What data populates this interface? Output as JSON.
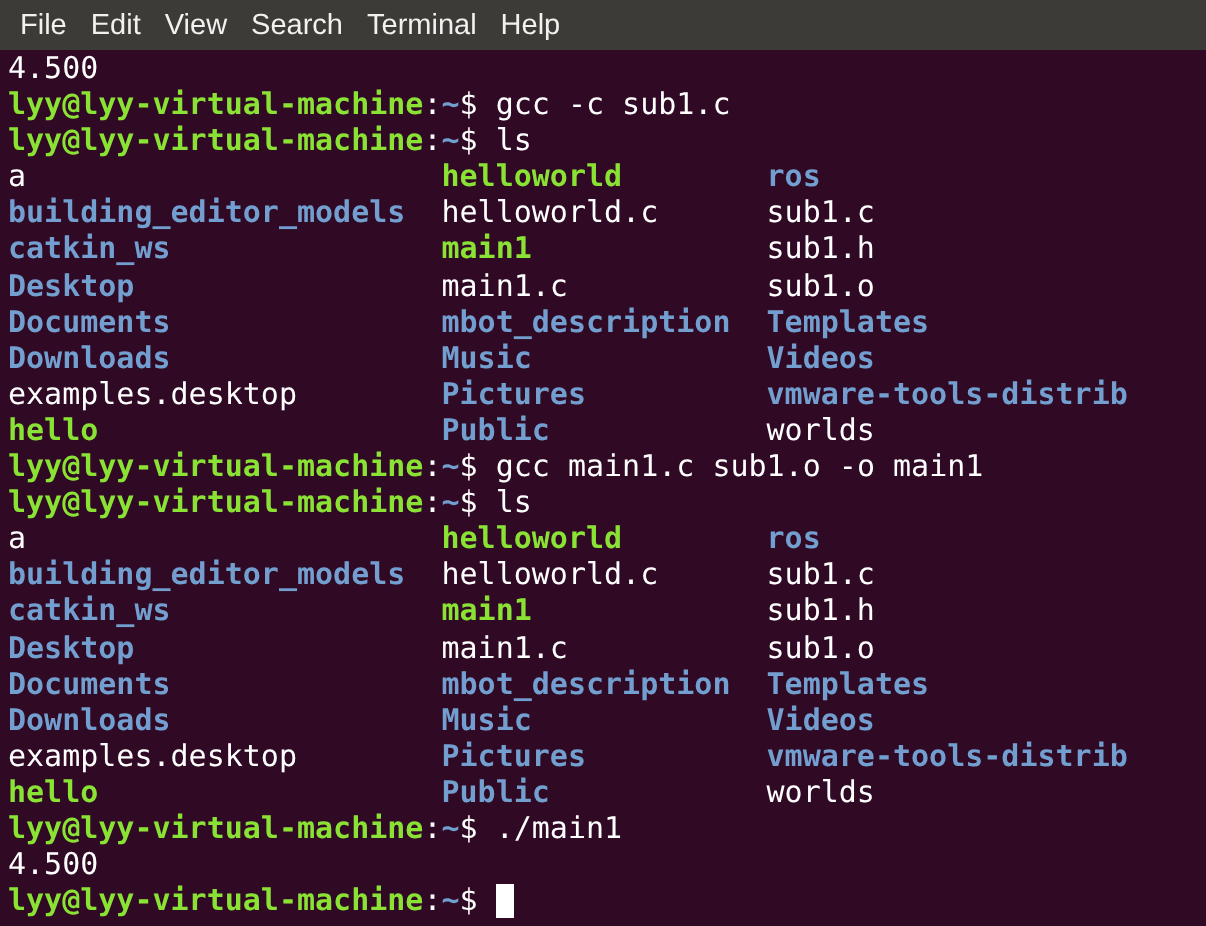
{
  "menu": [
    {
      "label": "File"
    },
    {
      "label": "Edit"
    },
    {
      "label": "View"
    },
    {
      "label": "Search"
    },
    {
      "label": "Terminal"
    },
    {
      "label": "Help"
    }
  ],
  "lines": [
    {
      "kind": "output",
      "text": "4.500"
    },
    {
      "kind": "prompt",
      "user_host": "lyy@lyy-virtual-machine",
      "separator": ":",
      "path": "~",
      "symbol": "$",
      "command": "gcc -c sub1.c",
      "cursor": false
    },
    {
      "kind": "prompt",
      "user_host": "lyy@lyy-virtual-machine",
      "separator": ":",
      "path": "~",
      "symbol": "$",
      "command": "ls",
      "cursor": false
    },
    {
      "kind": "listing",
      "cells": [
        {
          "text": "a",
          "kind": "file"
        },
        {
          "text": "helloworld",
          "kind": "exec"
        },
        {
          "text": "ros",
          "kind": "dir"
        }
      ]
    },
    {
      "kind": "listing",
      "cells": [
        {
          "text": "building_editor_models",
          "kind": "dir"
        },
        {
          "text": "helloworld.c",
          "kind": "file"
        },
        {
          "text": "sub1.c",
          "kind": "file"
        }
      ]
    },
    {
      "kind": "listing",
      "cells": [
        {
          "text": "catkin_ws",
          "kind": "dir"
        },
        {
          "text": "main1",
          "kind": "exec"
        },
        {
          "text": "sub1.h",
          "kind": "file"
        }
      ]
    },
    {
      "kind": "listing",
      "cells": [
        {
          "text": "Desktop",
          "kind": "dir"
        },
        {
          "text": "main1.c",
          "kind": "file"
        },
        {
          "text": "sub1.o",
          "kind": "file"
        }
      ]
    },
    {
      "kind": "listing",
      "cells": [
        {
          "text": "Documents",
          "kind": "dir"
        },
        {
          "text": "mbot_description",
          "kind": "dir"
        },
        {
          "text": "Templates",
          "kind": "dir"
        }
      ]
    },
    {
      "kind": "listing",
      "cells": [
        {
          "text": "Downloads",
          "kind": "dir"
        },
        {
          "text": "Music",
          "kind": "dir"
        },
        {
          "text": "Videos",
          "kind": "dir"
        }
      ]
    },
    {
      "kind": "listing",
      "cells": [
        {
          "text": "examples.desktop",
          "kind": "file"
        },
        {
          "text": "Pictures",
          "kind": "dir"
        },
        {
          "text": "vmware-tools-distrib",
          "kind": "dir"
        }
      ]
    },
    {
      "kind": "listing",
      "cells": [
        {
          "text": "hello",
          "kind": "exec"
        },
        {
          "text": "Public",
          "kind": "dir"
        },
        {
          "text": "worlds",
          "kind": "file"
        }
      ]
    },
    {
      "kind": "prompt",
      "user_host": "lyy@lyy-virtual-machine",
      "separator": ":",
      "path": "~",
      "symbol": "$",
      "command": "gcc main1.c sub1.o -o main1",
      "cursor": false
    },
    {
      "kind": "prompt",
      "user_host": "lyy@lyy-virtual-machine",
      "separator": ":",
      "path": "~",
      "symbol": "$",
      "command": "ls",
      "cursor": false
    },
    {
      "kind": "listing",
      "cells": [
        {
          "text": "a",
          "kind": "file"
        },
        {
          "text": "helloworld",
          "kind": "exec"
        },
        {
          "text": "ros",
          "kind": "dir"
        }
      ]
    },
    {
      "kind": "listing",
      "cells": [
        {
          "text": "building_editor_models",
          "kind": "dir"
        },
        {
          "text": "helloworld.c",
          "kind": "file"
        },
        {
          "text": "sub1.c",
          "kind": "file"
        }
      ]
    },
    {
      "kind": "listing",
      "cells": [
        {
          "text": "catkin_ws",
          "kind": "dir"
        },
        {
          "text": "main1",
          "kind": "exec"
        },
        {
          "text": "sub1.h",
          "kind": "file"
        }
      ]
    },
    {
      "kind": "listing",
      "cells": [
        {
          "text": "Desktop",
          "kind": "dir"
        },
        {
          "text": "main1.c",
          "kind": "file"
        },
        {
          "text": "sub1.o",
          "kind": "file"
        }
      ]
    },
    {
      "kind": "listing",
      "cells": [
        {
          "text": "Documents",
          "kind": "dir"
        },
        {
          "text": "mbot_description",
          "kind": "dir"
        },
        {
          "text": "Templates",
          "kind": "dir"
        }
      ]
    },
    {
      "kind": "listing",
      "cells": [
        {
          "text": "Downloads",
          "kind": "dir"
        },
        {
          "text": "Music",
          "kind": "dir"
        },
        {
          "text": "Videos",
          "kind": "dir"
        }
      ]
    },
    {
      "kind": "listing",
      "cells": [
        {
          "text": "examples.desktop",
          "kind": "file"
        },
        {
          "text": "Pictures",
          "kind": "dir"
        },
        {
          "text": "vmware-tools-distrib",
          "kind": "dir"
        }
      ]
    },
    {
      "kind": "listing",
      "cells": [
        {
          "text": "hello",
          "kind": "exec"
        },
        {
          "text": "Public",
          "kind": "dir"
        },
        {
          "text": "worlds",
          "kind": "file"
        }
      ]
    },
    {
      "kind": "prompt",
      "user_host": "lyy@lyy-virtual-machine",
      "separator": ":",
      "path": "~",
      "symbol": "$",
      "command": "./main1",
      "cursor": false
    },
    {
      "kind": "output",
      "text": "4.500"
    },
    {
      "kind": "prompt",
      "user_host": "lyy@lyy-virtual-machine",
      "separator": ":",
      "path": "~",
      "symbol": "$",
      "cursor": true
    }
  ]
}
